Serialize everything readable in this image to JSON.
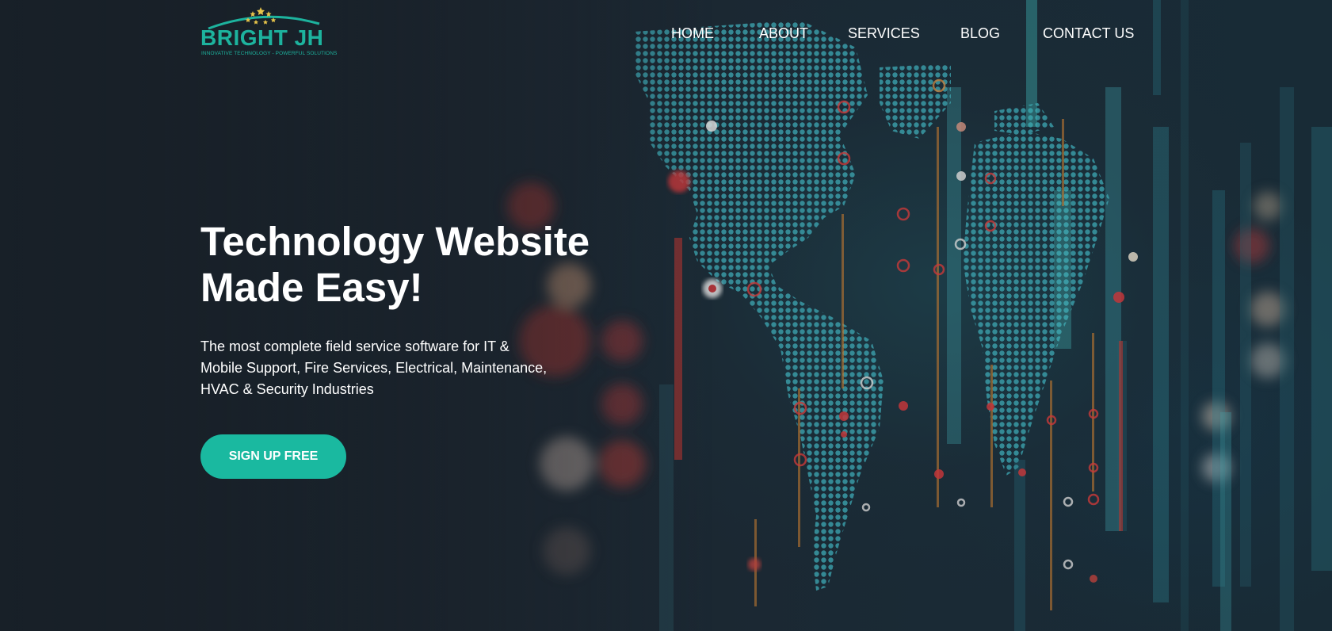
{
  "brand": {
    "logo_word": "BRIGHT JH",
    "tagline": "INNOVATIVE TECHNOLOGY - POWERFUL SOLUTIONS",
    "accent_color": "#1ab9a0",
    "logo_icon": "stars-arc-icon"
  },
  "nav": {
    "items": [
      {
        "label": "HOME"
      },
      {
        "label": "ABOUT"
      },
      {
        "label": "SERVICES"
      },
      {
        "label": "BLOG"
      },
      {
        "label": "CONTACT US"
      }
    ]
  },
  "hero": {
    "headline_line1": "Technology Website",
    "headline_line2": "Made Easy!",
    "description": "The most complete field service software for IT & Mobile Support, Fire Services, Electrical, Maintenance, HVAC & Security Industries",
    "cta_label": "SIGN UP FREE",
    "background": "world-map-dots-data-bars"
  }
}
